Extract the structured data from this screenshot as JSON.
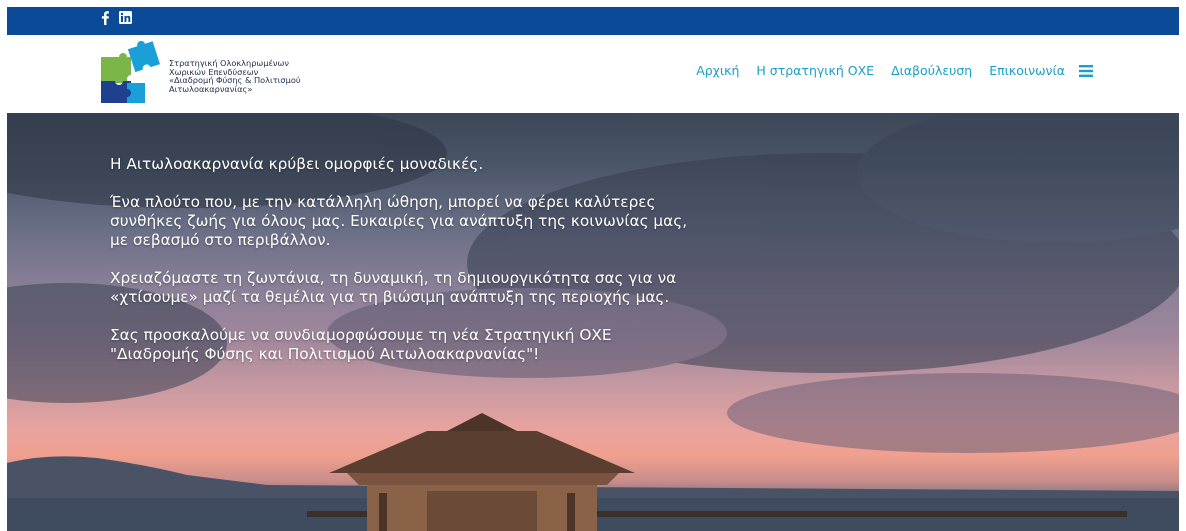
{
  "topbar": {
    "social": [
      {
        "icon": "facebook-icon",
        "label": "f"
      },
      {
        "icon": "linkedin-icon",
        "label": "in"
      }
    ],
    "color": "#0a4a96"
  },
  "logo": {
    "lines": [
      "Στρατηγική Ολοκληρωμένων",
      "Χωρικών Επενδύσεων",
      "«Διαδρομή Φύσης & Πολιτισμού",
      "Αιτωλοακαρνανίας»"
    ],
    "colors": [
      "#7ab648",
      "#1a9fd8",
      "#1f3f8f"
    ]
  },
  "nav": {
    "items": [
      {
        "label": "Αρχική"
      },
      {
        "label": "Η στρατηγική ΟΧΕ"
      },
      {
        "label": "Διαβούλευση"
      },
      {
        "label": "Επικοινωνία"
      }
    ],
    "menu_icon": "hamburger-menu-icon",
    "color": "#1aa0c8"
  },
  "hero": {
    "paragraphs": [
      "Η Αιτωλοακαρνανία κρύβει ομορφιές μοναδικές.",
      "Ένα πλούτο που, με την κατάλληλη ώθηση, μπορεί να φέρει καλύτερες συνθήκες ζωής για όλους μας. Ευκαιρίες για ανάπτυξη της κοινωνίας μας, με σεβασμό στο περιβάλλον.",
      "Χρειαζόμαστε τη ζωντάνια, τη δυναμική, τη δημιουργικότητα σας για να «χτίσουμε» μαζί τα θεμέλια για τη βιώσιμη ανάπτυξη της περιοχής μας.",
      "Σας προσκαλούμε να συνδιαμορφώσουμε τη νέα Στρατηγική ΟΧΕ \"Διαδρομής Φύσης και Πολιτισμού Αιτωλοακαρνανίας\"!"
    ]
  }
}
